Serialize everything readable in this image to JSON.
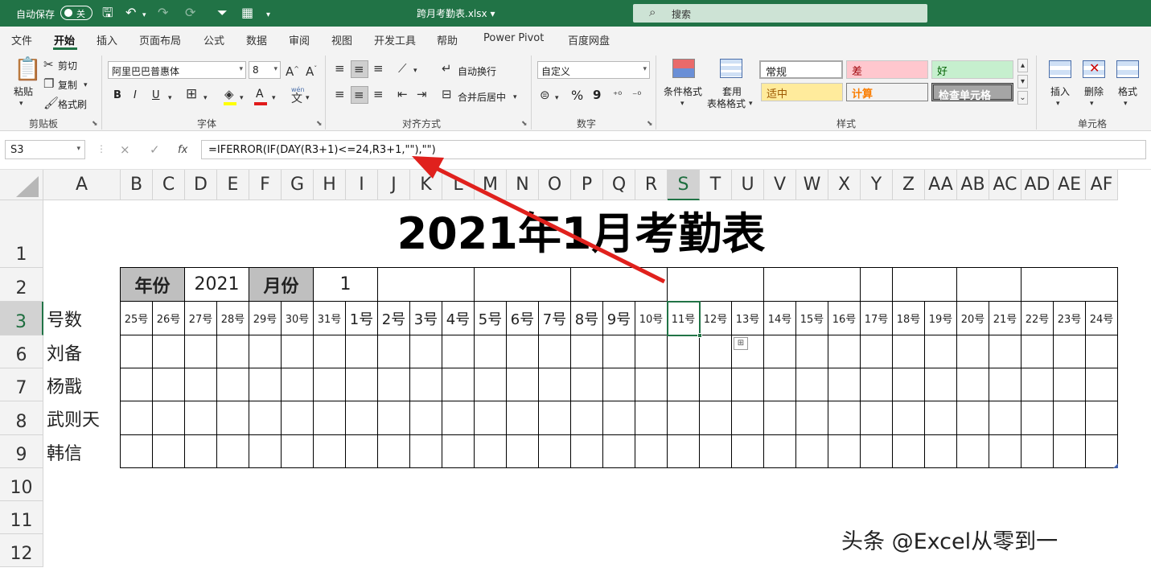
{
  "titlebar": {
    "autosave_label": "自动保存",
    "autosave_state": "关",
    "filename": "跨月考勤表.xlsx",
    "filename_caret": "▾",
    "search_placeholder": "搜索",
    "accent": "#217346"
  },
  "menu": {
    "tabs": [
      "文件",
      "开始",
      "插入",
      "页面布局",
      "公式",
      "数据",
      "审阅",
      "视图",
      "开发工具",
      "帮助",
      "Power Pivot",
      "百度网盘"
    ],
    "active_index": 1
  },
  "ribbon": {
    "clipboard": {
      "paste": "粘贴",
      "cut": "剪切",
      "copy": "复制",
      "format_painter": "格式刷",
      "group": "剪贴板"
    },
    "font": {
      "name": "阿里巴巴普惠体",
      "size": "8",
      "grow": "A^",
      "shrink": "A˅",
      "bold": "B",
      "italic": "I",
      "underline": "U",
      "group": "字体",
      "pinyin": "wén"
    },
    "alignment": {
      "wrap": "自动换行",
      "merge": "合并后居中",
      "group": "对齐方式"
    },
    "number": {
      "format": "自定义",
      "percent": "%",
      "comma": "9",
      "group": "数字"
    },
    "styles": {
      "conditional": "条件格式",
      "table_line1": "套用",
      "table_line2": "表格格式",
      "normal": "常规",
      "bad": "差",
      "good": "好",
      "neutral": "适中",
      "calc": "计算",
      "check": "检查单元格",
      "group": "样式"
    },
    "cells": {
      "insert": "插入",
      "delete": "删除",
      "format": "格式",
      "group": "单元格"
    }
  },
  "formula_bar": {
    "name_box": "S3",
    "cancel": "×",
    "confirm": "✓",
    "fx": "fx",
    "formula": "=IFERROR(IF(DAY(R3+1)<=24,R3+1,\"\"),\"\")"
  },
  "sheet": {
    "columns": [
      "A",
      "B",
      "C",
      "D",
      "E",
      "F",
      "G",
      "H",
      "I",
      "J",
      "K",
      "L",
      "M",
      "N",
      "O",
      "P",
      "Q",
      "R",
      "S",
      "T",
      "U",
      "V",
      "W",
      "X",
      "Y",
      "Z",
      "AA",
      "AB",
      "AC",
      "AD",
      "AE",
      "AF"
    ],
    "selected_column": "S",
    "rows": [
      "1",
      "2",
      "3",
      "6",
      "7",
      "8",
      "9",
      "10",
      "11",
      "12"
    ],
    "selected_row": "3",
    "title": "2021年1月考勤表",
    "year_label": "年份",
    "year_value": "2021",
    "month_label": "月份",
    "month_value": "1",
    "day_header_label": "号数",
    "days": [
      "25号",
      "26号",
      "27号",
      "28号",
      "29号",
      "30号",
      "31号",
      "1号",
      "2号",
      "3号",
      "4号",
      "5号",
      "6号",
      "7号",
      "8号",
      "9号",
      "10号",
      "11号",
      "12号",
      "13号",
      "14号",
      "15号",
      "16号",
      "17号",
      "18号",
      "19号",
      "20号",
      "21号",
      "22号",
      "23号",
      "24号"
    ],
    "employees": [
      "刘备",
      "杨戬",
      "武则天",
      "韩信"
    ],
    "header_fill": "#bfbfbf"
  },
  "annotation": {
    "arrow_color": "#e0211d"
  },
  "watermark": "头条 @Excel从零到一"
}
